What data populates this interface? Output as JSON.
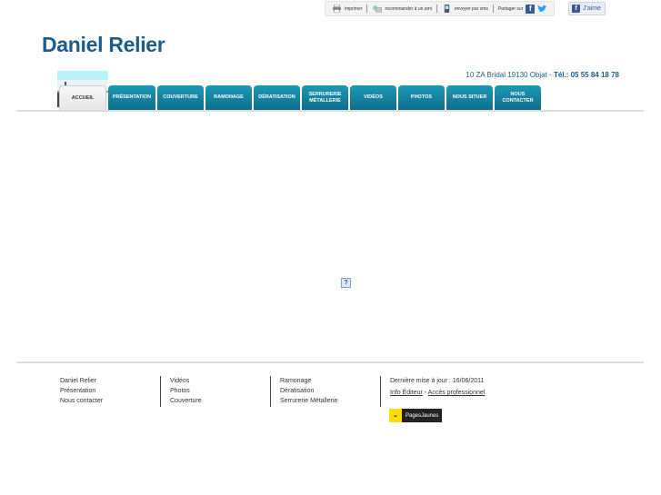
{
  "topbar": {
    "print_label": "imprimer",
    "recommend_label": "recommander à un ami",
    "sms_label": "envoyer par sms",
    "share_label": "Partager sur"
  },
  "like": {
    "label": "J'aime"
  },
  "site": {
    "title": "Daniel Relier"
  },
  "contact": {
    "address": "10 ZA Bridal 19130 Objat -",
    "phone": "Tél.: 05 55 84 18 78"
  },
  "nav": {
    "tabs": [
      {
        "label": "ACCUEIL",
        "active": true
      },
      {
        "label": "PRÉSENTATION"
      },
      {
        "label": "COUVERTURE"
      },
      {
        "label": "RAMONAGE"
      },
      {
        "label": "DÉRATISATION"
      },
      {
        "label": "SERRURERIE MÉTALLERIE"
      },
      {
        "label": "VIDÉOS"
      },
      {
        "label": "PHOTOS"
      },
      {
        "label": "NOUS SITUER"
      },
      {
        "label": "NOUS CONTACTER"
      }
    ]
  },
  "main": {
    "broken_image_glyph": "?"
  },
  "footer": {
    "col1": [
      "Daniel Relier",
      "Présentation",
      "Nous contacter"
    ],
    "col2": [
      "Vidéos",
      "Photos",
      "Couverture"
    ],
    "col3": [
      "Ramonage",
      "Dératisation",
      "Serrurerie Métallerie"
    ],
    "update": "Dernière mise à jour : 16/06/2011",
    "info_editeur": "Info Éditeur",
    "dash": " - ",
    "acces_pro": "Accès professionnel",
    "pj_face": "ᵕ",
    "pj_label": "PagesJaunes"
  },
  "colors": {
    "brand": "#1c5c8a",
    "tab": "#1686a5",
    "pj_yellow": "#ffde00"
  }
}
